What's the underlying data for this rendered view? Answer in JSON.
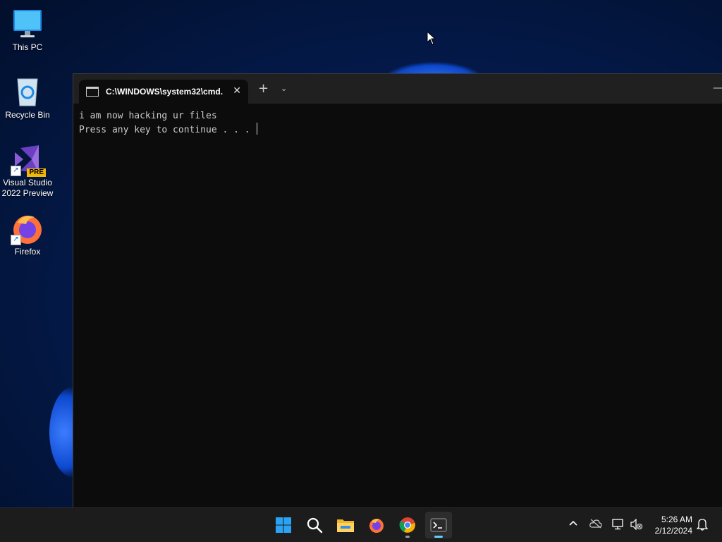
{
  "desktop": {
    "icons": [
      {
        "label": "This PC"
      },
      {
        "label": "Recycle Bin"
      },
      {
        "label": "Visual Studio 2022 Preview",
        "badge": "PRE"
      },
      {
        "label": "Firefox"
      }
    ]
  },
  "terminal": {
    "tab_title": "C:\\WINDOWS\\system32\\cmd.",
    "close_glyph": "✕",
    "new_tab_glyph": "+",
    "dropdown_glyph": "⌄",
    "minimize_glyph": "—",
    "lines": [
      "i am now hacking ur files",
      "Press any key to continue . . . "
    ]
  },
  "taskbar": {
    "apps": [
      "start-icon",
      "search-icon",
      "file-explorer-icon",
      "firefox-icon",
      "chrome-icon",
      "terminal-icon"
    ],
    "tray_chevron": "^",
    "time": "5:26 AM",
    "date": "2/12/2024"
  },
  "colors": {
    "terminal_bg": "#0c0c0c",
    "titlebar_bg": "#202020",
    "taskbar_bg": "#1c1c1c",
    "accent": "#60cdff"
  }
}
